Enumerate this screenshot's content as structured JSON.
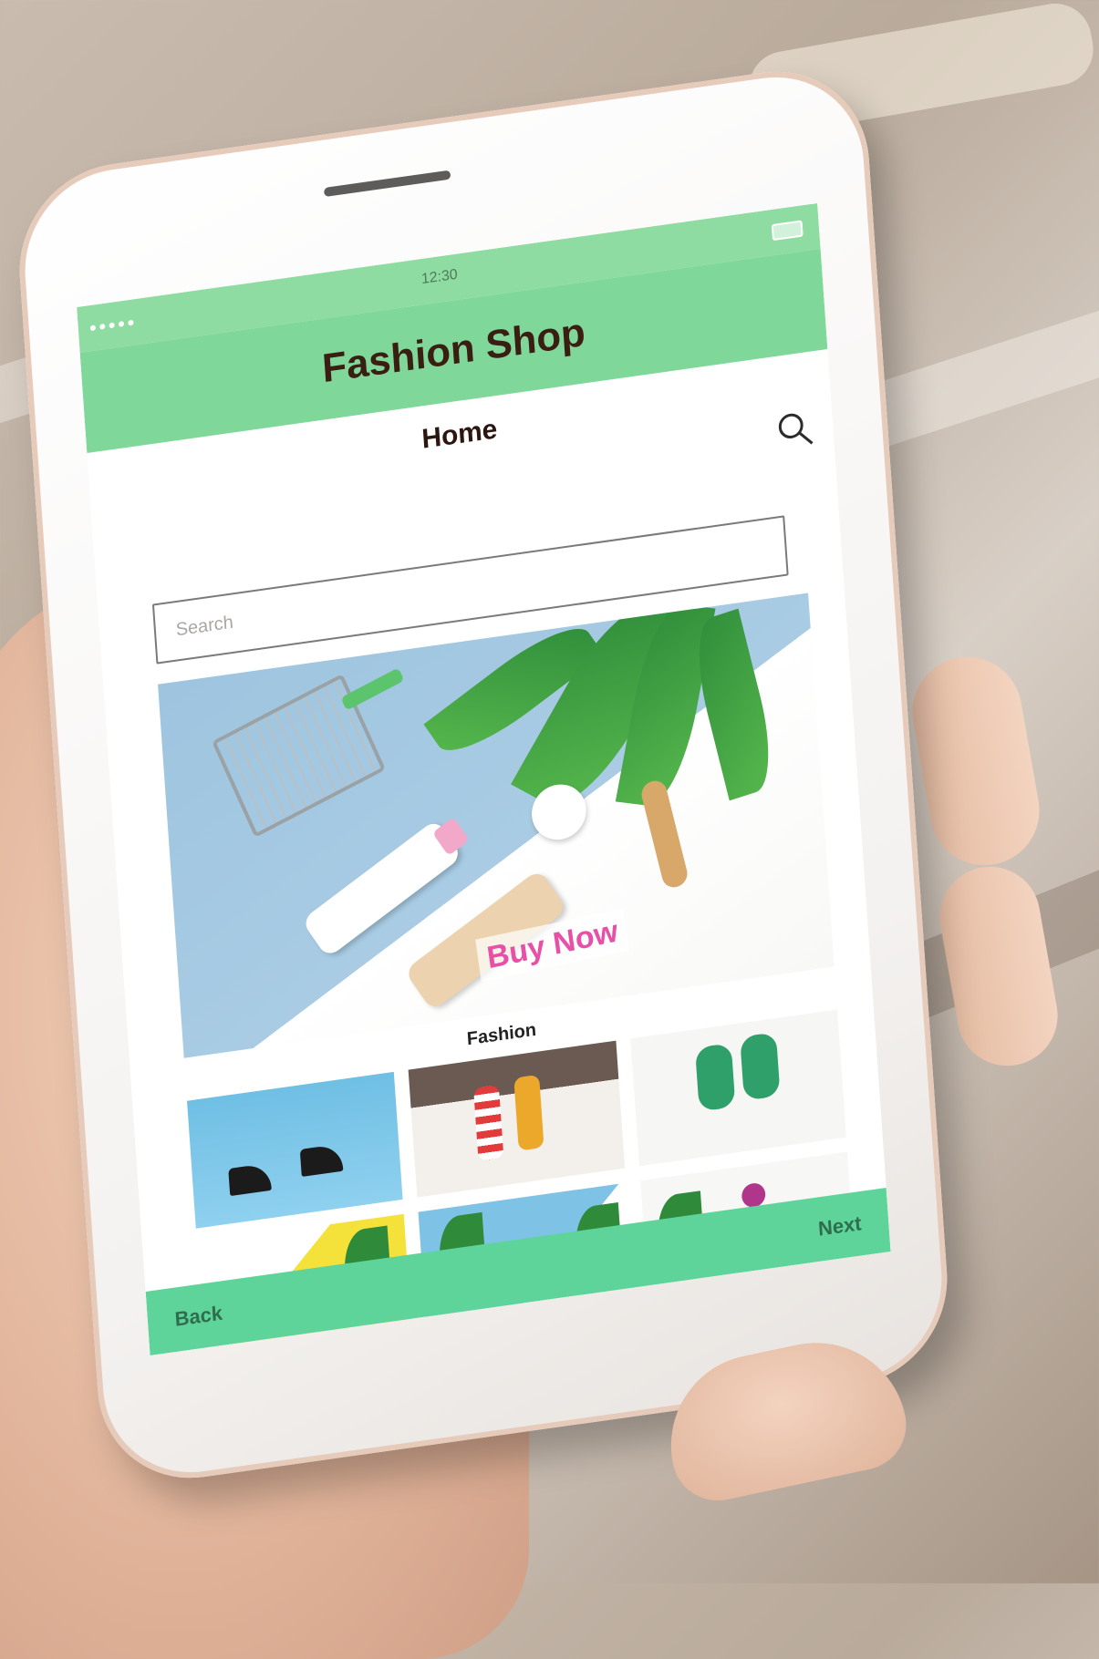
{
  "status_bar": {
    "signal_dots": "●●●●●",
    "time": "12:30"
  },
  "header": {
    "app_title": "Fashion Shop"
  },
  "page": {
    "title": "Home"
  },
  "search": {
    "placeholder": "Search",
    "value": ""
  },
  "banner": {
    "cta_label": "Buy Now"
  },
  "section": {
    "title": "Fashion"
  },
  "grid": {
    "tiles": [
      {
        "icon": "high-heels"
      },
      {
        "icon": "socks"
      },
      {
        "icon": "green-slippers"
      },
      {
        "icon": "coconut-cosmetics"
      },
      {
        "icon": "palm-cosmetics"
      },
      {
        "icon": "flowers-cosmetics"
      }
    ]
  },
  "nav": {
    "back_label": "Back",
    "next_label": "Next"
  },
  "colors": {
    "header_green": "#7fd89a",
    "bottom_bar_green": "#5fd49a",
    "title_brown": "#3a1e12",
    "cta_pink": "#e84fa6"
  }
}
